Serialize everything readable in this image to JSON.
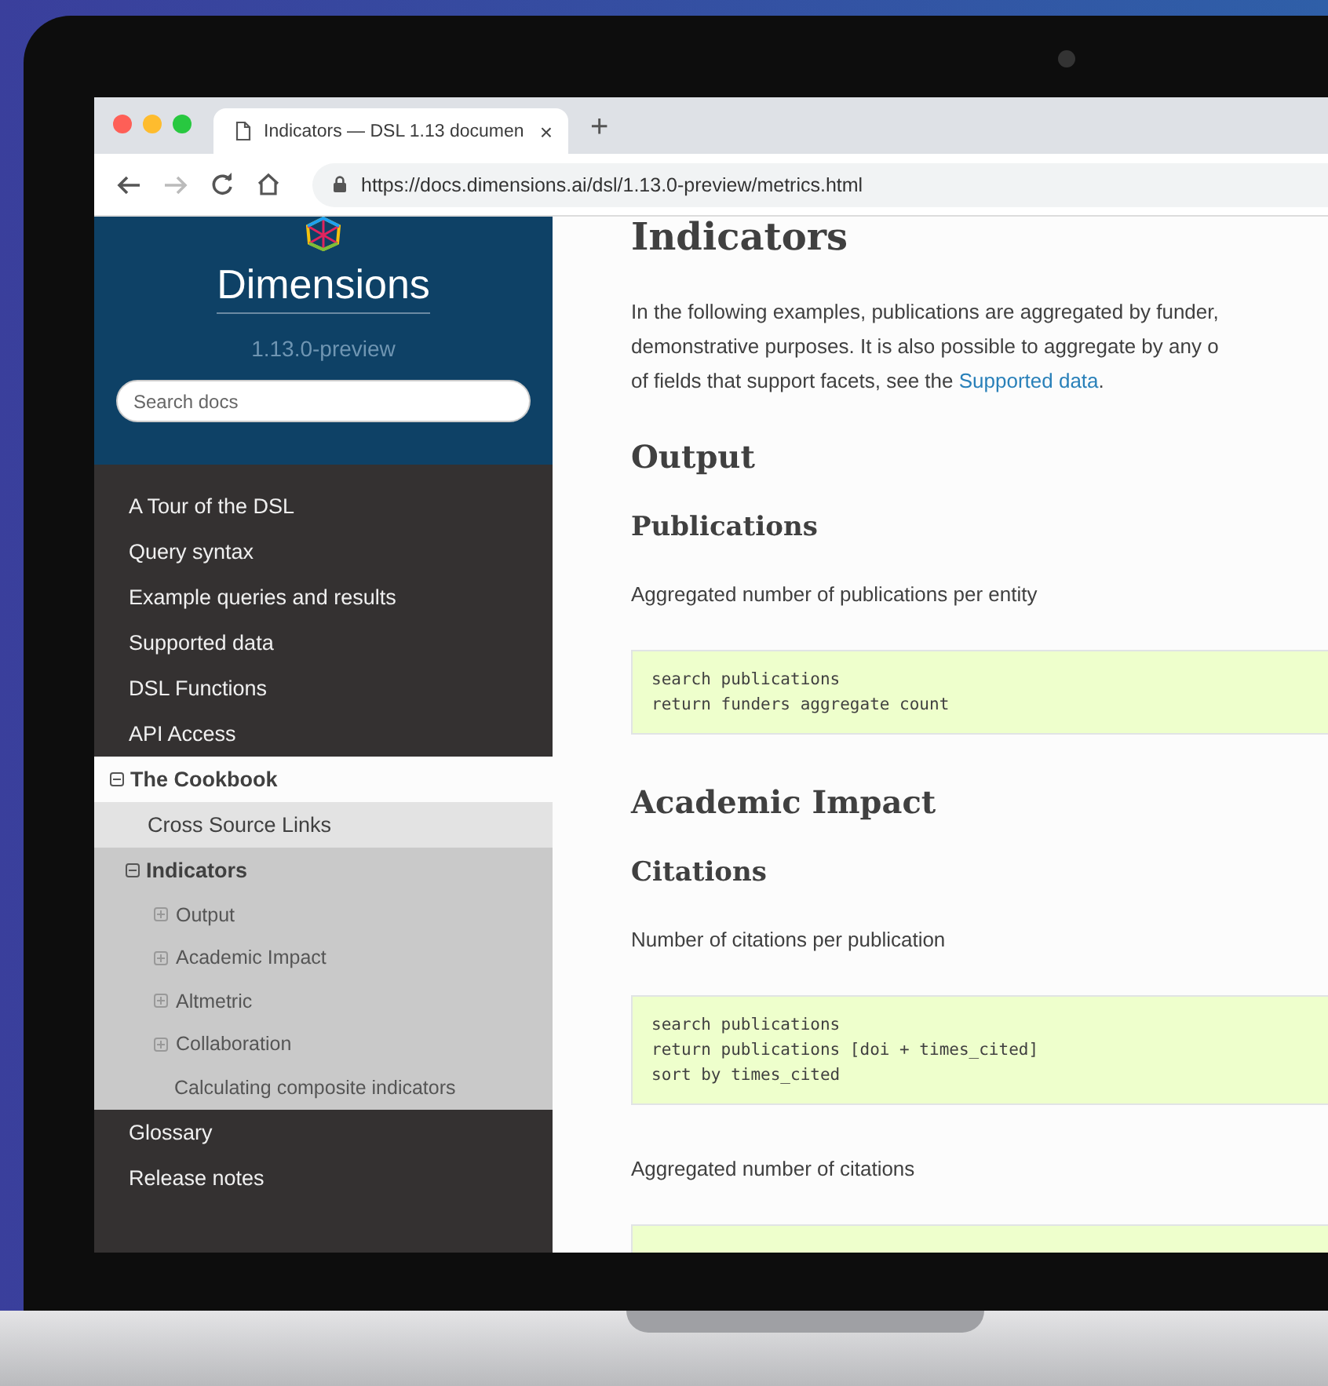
{
  "browser": {
    "tab": {
      "title": "Indicators — DSL 1.13 documen",
      "close": "×"
    },
    "new_tab": "+",
    "url": "https://docs.dimensions.ai/dsl/1.13.0-preview/metrics.html"
  },
  "sidebar": {
    "logo_text": "Dimensions",
    "version": "1.13.0-preview",
    "search": {
      "placeholder": "Search docs"
    },
    "nav": [
      {
        "label": "A Tour of the DSL",
        "selected": false
      },
      {
        "label": "Query syntax",
        "selected": false
      },
      {
        "label": "Example queries and results",
        "selected": false
      },
      {
        "label": "Supported data",
        "selected": false
      },
      {
        "label": "DSL Functions",
        "selected": false
      },
      {
        "label": "API Access",
        "selected": false
      },
      {
        "label": "The Cookbook",
        "selected": true,
        "expanded": true,
        "children": [
          {
            "label": "Cross Source Links",
            "selected": false,
            "kind": "leaf"
          },
          {
            "label": "Indicators",
            "selected": true,
            "kind": "branch",
            "expanded": true,
            "children": [
              {
                "label": "Output",
                "kind": "branch",
                "expanded": false
              },
              {
                "label": "Academic Impact",
                "kind": "branch",
                "expanded": false
              },
              {
                "label": "Altmetric",
                "kind": "branch",
                "expanded": false
              },
              {
                "label": "Collaboration",
                "kind": "branch",
                "expanded": false
              },
              {
                "label": "Calculating composite indicators",
                "kind": "leaf"
              }
            ]
          }
        ]
      },
      {
        "label": "Glossary",
        "selected": false
      },
      {
        "label": "Release notes",
        "selected": false
      }
    ]
  },
  "content": [
    {
      "kind": "h1",
      "text": "Indicators"
    },
    {
      "kind": "p",
      "lines": [
        "In the following examples, publications are aggregated by funder,",
        "demonstrative purposes. It is also possible to aggregate by any o",
        "of fields that support facets, see the "
      ],
      "link": "Supported data",
      "after": "."
    },
    {
      "kind": "h2",
      "text": "Output"
    },
    {
      "kind": "h3",
      "text": "Publications"
    },
    {
      "kind": "p",
      "lines": [
        "Aggregated number of publications per entity"
      ]
    },
    {
      "kind": "code",
      "lines": [
        "search publications",
        "return funders aggregate count"
      ]
    },
    {
      "kind": "h2",
      "text": "Academic Impact"
    },
    {
      "kind": "h3",
      "text": "Citations"
    },
    {
      "kind": "p",
      "lines": [
        "Number of citations per publication"
      ]
    },
    {
      "kind": "code",
      "lines": [
        "search publications",
        "return publications [doi + times_cited]",
        "sort by times_cited"
      ]
    },
    {
      "kind": "p",
      "lines": [
        "Aggregated number of citations"
      ]
    },
    {
      "kind": "code"
    }
  ]
}
